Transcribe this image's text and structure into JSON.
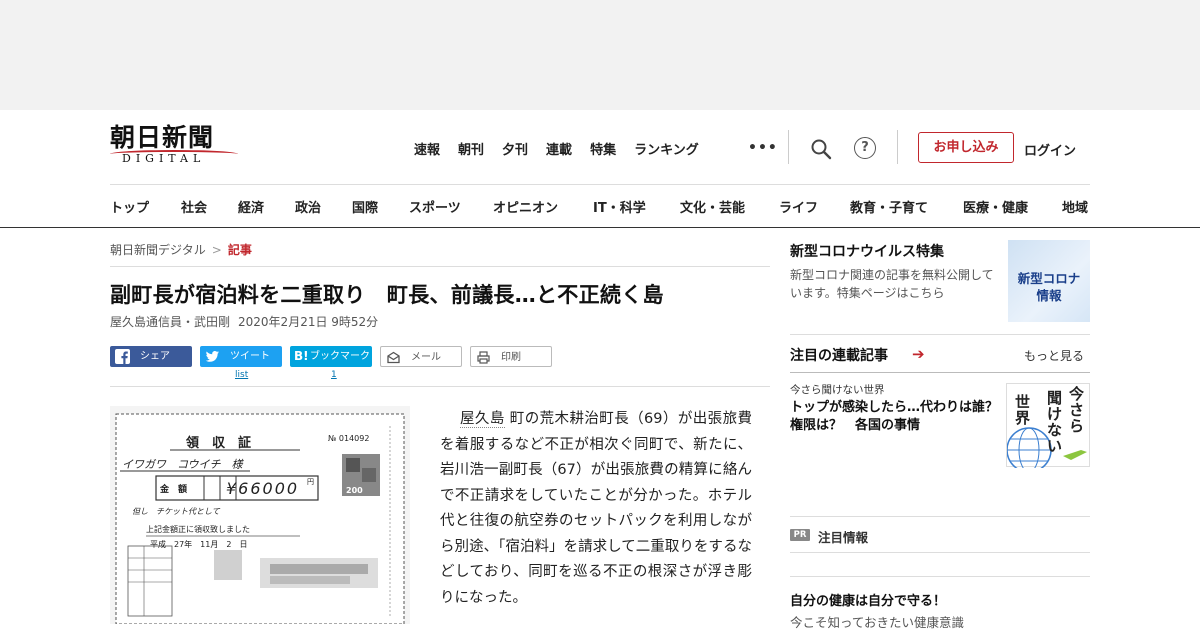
{
  "header": {
    "logo_main": "朝日新聞",
    "logo_sub": "DIGITAL",
    "top_nav": [
      "速報",
      "朝刊",
      "夕刊",
      "連載",
      "特集",
      "ランキング"
    ],
    "more_icon": "•••",
    "help_icon": "?",
    "subscribe": "お申し込み",
    "login": "ログイン",
    "categories": [
      "トップ",
      "社会",
      "経済",
      "政治",
      "国際",
      "スポーツ",
      "オピニオン",
      "IT・科学",
      "文化・芸能",
      "ライフ",
      "教育・子育て",
      "医療・健康",
      "地域"
    ]
  },
  "breadcrumb": {
    "home": "朝日新聞デジタル",
    "separator": ">",
    "current": "記事"
  },
  "article": {
    "headline": "副町長が宿泊料を二重取り　町長、前議長…と不正続く島",
    "author": "屋久島通信員・武田剛",
    "date": "2020年2月21日 9時52分",
    "body_keyword": "屋久島",
    "body_rest": " 町の荒木耕治町長（69）が出張旅費を着服するなど不正が相次ぐ同町で、新たに、岩川浩一副町長（67）が出張旅費の精算に絡んで不正請求をしていたことが分かった。ホテル代と往復の航空券のセットパックを利用しながら別途、「宿泊料」を請求して二重取りをするなどしており、同町を巡る不正の根深さが浮き彫りになった。"
  },
  "share": {
    "facebook": "シェア",
    "twitter": "ツイート",
    "twitter_count": "list",
    "hatena": "ブックマーク",
    "hatena_count": "1",
    "mail": "メール",
    "print": "印刷"
  },
  "receipt": {
    "title": "領　収　証",
    "number": "№ 014092",
    "payee": "イワガワ　コウイチ　様",
    "amount_label": "金　額",
    "amount": "¥66000",
    "yen": "円",
    "note": "但し　チケット代として",
    "received": "上記金額正に領収致しました",
    "date": "平成　27年　11月　2　日",
    "stamp": "200"
  },
  "sidebar": {
    "feature_title": "新型コロナウイルス特集",
    "feature_desc": "新型コロナ関連の記事を無料公開しています。特集ページはこちら",
    "feature_thumb_line1": "新型コロナ",
    "feature_thumb_line2": "情報",
    "serial_heading": "注目の連載記事",
    "serial_more": "もっと見る",
    "serial_category": "今さら聞けない世界",
    "serial_title": "トップが感染したら…代わりは誰？権限は？　各国の事情",
    "imasara_thumb": [
      "今",
      "さ",
      "ら",
      "聞",
      "け",
      "な",
      "い",
      "世",
      "界"
    ],
    "pr_badge": "PR",
    "pr_label": "注目情報",
    "promo_title": "自分の健康は自分で守る！",
    "promo_sub": "今こそ知っておきたい健康意識"
  },
  "colors": {
    "brand_red": "#c1272d",
    "facebook": "#3b5a9a",
    "twitter": "#1da1f2",
    "hatena": "#00a4de"
  }
}
